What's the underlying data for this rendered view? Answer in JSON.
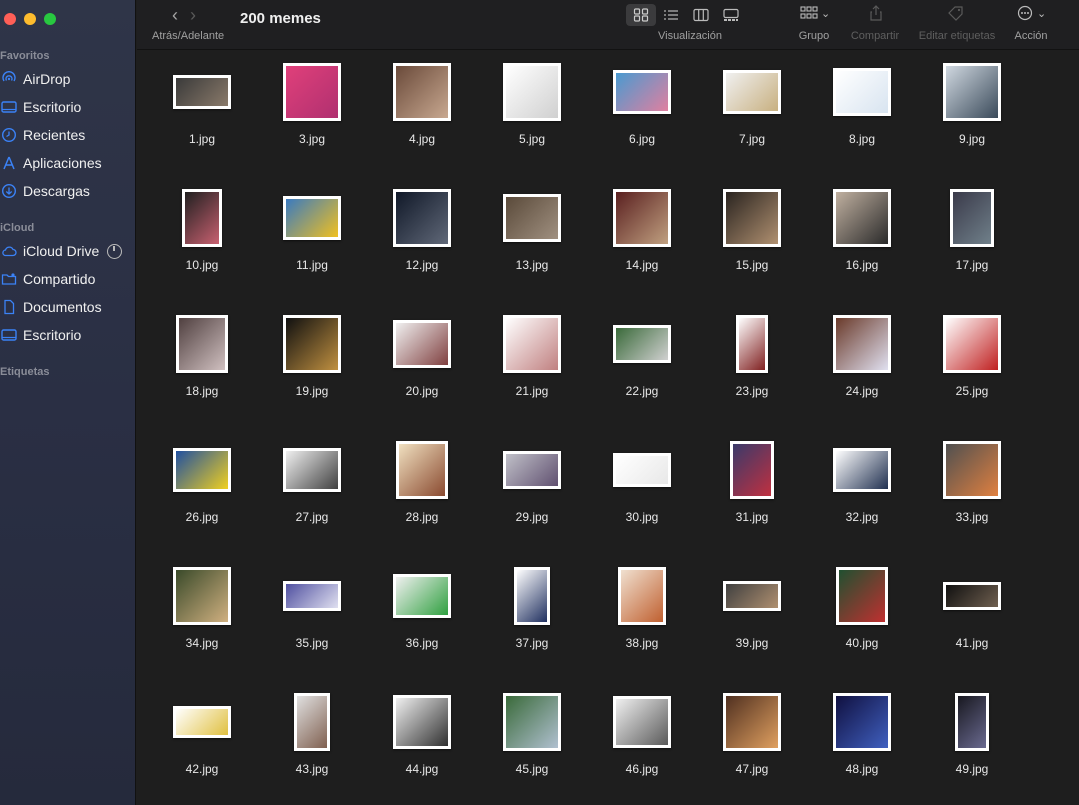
{
  "window": {
    "title": "200 memes"
  },
  "toolbar": {
    "nav_label": "Atrás/Adelante",
    "view_label": "Visualización",
    "group_label": "Grupo",
    "share_label": "Compartir",
    "tags_label": "Editar etiquetas",
    "action_label": "Acción"
  },
  "sidebar": {
    "favorites_header": "Favoritos",
    "icloud_header": "iCloud",
    "tags_header": "Etiquetas",
    "favorites": [
      {
        "label": "AirDrop",
        "icon": "airdrop-icon"
      },
      {
        "label": "Escritorio",
        "icon": "desktop-icon"
      },
      {
        "label": "Recientes",
        "icon": "clock-icon"
      },
      {
        "label": "Aplicaciones",
        "icon": "applications-icon"
      },
      {
        "label": "Descargas",
        "icon": "download-icon"
      }
    ],
    "icloud": [
      {
        "label": "iCloud Drive",
        "icon": "cloud-icon"
      },
      {
        "label": "Compartido",
        "icon": "shared-folder-icon"
      },
      {
        "label": "Documentos",
        "icon": "document-icon"
      },
      {
        "label": "Escritorio",
        "icon": "desktop-icon"
      }
    ]
  },
  "files": [
    {
      "name": "1.jpg",
      "w": 58,
      "h": 34,
      "c1": "#3a3a3a",
      "c2": "#8a7a6a"
    },
    {
      "name": "3.jpg",
      "w": 58,
      "h": 58,
      "c1": "#e0407a",
      "c2": "#b03070"
    },
    {
      "name": "4.jpg",
      "w": 58,
      "h": 58,
      "c1": "#6a4a3a",
      "c2": "#c8a890"
    },
    {
      "name": "5.jpg",
      "w": 58,
      "h": 58,
      "c1": "#ffffff",
      "c2": "#d0d0d0"
    },
    {
      "name": "6.jpg",
      "w": 58,
      "h": 44,
      "c1": "#4a9ad0",
      "c2": "#e080a0"
    },
    {
      "name": "7.jpg",
      "w": 58,
      "h": 44,
      "c1": "#f0f0f0",
      "c2": "#c8b080"
    },
    {
      "name": "8.jpg",
      "w": 58,
      "h": 48,
      "c1": "#ffffff",
      "c2": "#d8e4f0"
    },
    {
      "name": "9.jpg",
      "w": 58,
      "h": 58,
      "c1": "#d0d8e0",
      "c2": "#3a4a5a"
    },
    {
      "name": "10.jpg",
      "w": 40,
      "h": 58,
      "c1": "#202020",
      "c2": "#c86070"
    },
    {
      "name": "11.jpg",
      "w": 58,
      "h": 44,
      "c1": "#3a7ac0",
      "c2": "#f0c020"
    },
    {
      "name": "12.jpg",
      "w": 58,
      "h": 58,
      "c1": "#101828",
      "c2": "#606878"
    },
    {
      "name": "13.jpg",
      "w": 58,
      "h": 48,
      "c1": "#5a4a3a",
      "c2": "#a09080"
    },
    {
      "name": "14.jpg",
      "w": 58,
      "h": 58,
      "c1": "#5a2020",
      "c2": "#c0a080"
    },
    {
      "name": "15.jpg",
      "w": 58,
      "h": 58,
      "c1": "#2a2420",
      "c2": "#b09070"
    },
    {
      "name": "16.jpg",
      "w": 58,
      "h": 58,
      "c1": "#c0b0a0",
      "c2": "#2a2a2a"
    },
    {
      "name": "17.jpg",
      "w": 44,
      "h": 58,
      "c1": "#3a3a4a",
      "c2": "#70808a"
    },
    {
      "name": "18.jpg",
      "w": 52,
      "h": 58,
      "c1": "#504040",
      "c2": "#d0c0c0"
    },
    {
      "name": "19.jpg",
      "w": 58,
      "h": 58,
      "c1": "#101010",
      "c2": "#c09040"
    },
    {
      "name": "20.jpg",
      "w": 58,
      "h": 48,
      "c1": "#f0f0f0",
      "c2": "#804040"
    },
    {
      "name": "21.jpg",
      "w": 58,
      "h": 58,
      "c1": "#ffffff",
      "c2": "#c08080"
    },
    {
      "name": "22.jpg",
      "w": 58,
      "h": 38,
      "c1": "#3a6a3a",
      "c2": "#d0d0d0"
    },
    {
      "name": "23.jpg",
      "w": 32,
      "h": 58,
      "c1": "#ffffff",
      "c2": "#802020"
    },
    {
      "name": "24.jpg",
      "w": 58,
      "h": 58,
      "c1": "#6a3a2a",
      "c2": "#e0e0f0"
    },
    {
      "name": "25.jpg",
      "w": 58,
      "h": 58,
      "c1": "#ffffff",
      "c2": "#c02020"
    },
    {
      "name": "26.jpg",
      "w": 58,
      "h": 44,
      "c1": "#2050a0",
      "c2": "#f0d020"
    },
    {
      "name": "27.jpg",
      "w": 58,
      "h": 44,
      "c1": "#f0f0f0",
      "c2": "#404040"
    },
    {
      "name": "28.jpg",
      "w": 52,
      "h": 58,
      "c1": "#f0e0c0",
      "c2": "#8a4a30"
    },
    {
      "name": "29.jpg",
      "w": 58,
      "h": 38,
      "c1": "#c0c0c8",
      "c2": "#605070"
    },
    {
      "name": "30.jpg",
      "w": 58,
      "h": 34,
      "c1": "#ffffff",
      "c2": "#e8e8e8"
    },
    {
      "name": "31.jpg",
      "w": 44,
      "h": 58,
      "c1": "#3a3a6a",
      "c2": "#c03040"
    },
    {
      "name": "32.jpg",
      "w": 58,
      "h": 44,
      "c1": "#ffffff",
      "c2": "#203050"
    },
    {
      "name": "33.jpg",
      "w": 58,
      "h": 58,
      "c1": "#505050",
      "c2": "#e08040"
    },
    {
      "name": "34.jpg",
      "w": 58,
      "h": 58,
      "c1": "#3a4a2a",
      "c2": "#d0b080"
    },
    {
      "name": "35.jpg",
      "w": 58,
      "h": 30,
      "c1": "#5050a0",
      "c2": "#e0e0f0"
    },
    {
      "name": "36.jpg",
      "w": 58,
      "h": 44,
      "c1": "#f0f0f0",
      "c2": "#30a040"
    },
    {
      "name": "37.jpg",
      "w": 36,
      "h": 58,
      "c1": "#ffffff",
      "c2": "#203060"
    },
    {
      "name": "38.jpg",
      "w": 48,
      "h": 58,
      "c1": "#f0e0d0",
      "c2": "#c06030"
    },
    {
      "name": "39.jpg",
      "w": 58,
      "h": 30,
      "c1": "#404040",
      "c2": "#b09070"
    },
    {
      "name": "40.jpg",
      "w": 52,
      "h": 58,
      "c1": "#205030",
      "c2": "#c03030"
    },
    {
      "name": "41.jpg",
      "w": 58,
      "h": 28,
      "c1": "#101010",
      "c2": "#706050"
    },
    {
      "name": "42.jpg",
      "w": 58,
      "h": 32,
      "c1": "#ffffff",
      "c2": "#e0c040"
    },
    {
      "name": "43.jpg",
      "w": 36,
      "h": 58,
      "c1": "#e0e0e0",
      "c2": "#806050"
    },
    {
      "name": "44.jpg",
      "w": 58,
      "h": 54,
      "c1": "#f0f0f0",
      "c2": "#303030"
    },
    {
      "name": "45.jpg",
      "w": 58,
      "h": 58,
      "c1": "#3a6a3a",
      "c2": "#b0c0d0"
    },
    {
      "name": "46.jpg",
      "w": 58,
      "h": 52,
      "c1": "#f0f0f0",
      "c2": "#5a5a5a"
    },
    {
      "name": "47.jpg",
      "w": 58,
      "h": 58,
      "c1": "#503020",
      "c2": "#e0a060"
    },
    {
      "name": "48.jpg",
      "w": 58,
      "h": 58,
      "c1": "#101040",
      "c2": "#4060c0"
    },
    {
      "name": "49.jpg",
      "w": 34,
      "h": 58,
      "c1": "#181820",
      "c2": "#6a6a90"
    }
  ]
}
